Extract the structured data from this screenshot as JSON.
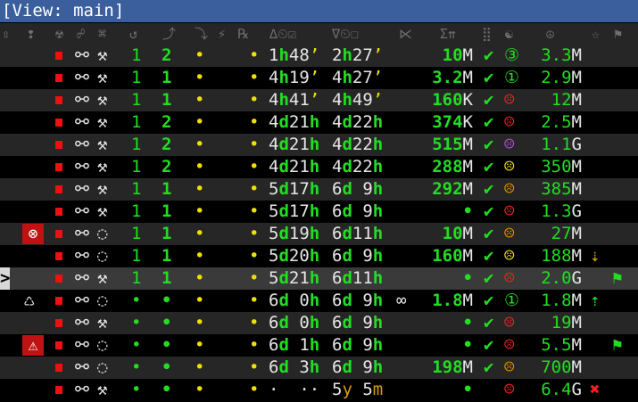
{
  "window": {
    "title": "[View: main]"
  },
  "header": {
    "columns": [
      "⇳",
      "❢",
      "☢",
      "☍",
      "⌘",
      "↺",
      "⤴",
      "⤵",
      "⚡",
      "℞",
      "∆⏲☑",
      "∇⏲☐",
      "⋉",
      "Σ⇈",
      "⣿",
      "☯",
      "☮",
      "☆",
      "⚑"
    ]
  },
  "rows": [
    {
      "cur": "",
      "icon": "",
      "red": true,
      "link": "⚯",
      "tool": "⚒",
      "a": "1",
      "b": "2",
      "c": "•",
      "d": "•",
      "t1": [
        [
          "1",
          "wht"
        ],
        [
          "h",
          "grn"
        ],
        [
          "48",
          "wht"
        ],
        [
          "’",
          "yel"
        ]
      ],
      "t2": [
        [
          "2",
          "wht"
        ],
        [
          "h",
          "grn"
        ],
        [
          "27",
          "wht"
        ],
        [
          "’",
          "yel"
        ]
      ],
      "inf": "",
      "size": [
        [
          "10",
          "grn"
        ],
        [
          "M",
          "wht"
        ]
      ],
      "chk": "✔",
      "face": "③",
      "fcol": "grn2",
      "tot": [
        [
          "3.3",
          "grn2"
        ],
        [
          "M",
          "wht"
        ]
      ],
      "ext": ""
    },
    {
      "cur": "",
      "icon": "",
      "red": true,
      "link": "⚯",
      "tool": "⚒",
      "a": "1",
      "b": "1",
      "c": "•",
      "d": "•",
      "t1": [
        [
          "4",
          "wht"
        ],
        [
          "h",
          "grn"
        ],
        [
          "19",
          "wht"
        ],
        [
          "’",
          "yel"
        ]
      ],
      "t2": [
        [
          "4",
          "wht"
        ],
        [
          "h",
          "grn"
        ],
        [
          "27",
          "wht"
        ],
        [
          "’",
          "yel"
        ]
      ],
      "inf": "",
      "size": [
        [
          "3.2",
          "grn"
        ],
        [
          "M",
          "wht"
        ]
      ],
      "chk": "✔",
      "face": "①",
      "fcol": "grn2",
      "tot": [
        [
          "2.9",
          "grn2"
        ],
        [
          "M",
          "wht"
        ]
      ],
      "ext": ""
    },
    {
      "cur": "",
      "icon": "",
      "red": true,
      "link": "⚯",
      "tool": "⚒",
      "a": "1",
      "b": "1",
      "c": "•",
      "d": "•",
      "t1": [
        [
          "4",
          "wht"
        ],
        [
          "h",
          "grn"
        ],
        [
          "41",
          "wht"
        ],
        [
          "’",
          "yel"
        ]
      ],
      "t2": [
        [
          "4",
          "wht"
        ],
        [
          "h",
          "grn"
        ],
        [
          "49",
          "wht"
        ],
        [
          "’",
          "yel"
        ]
      ],
      "inf": "",
      "size": [
        [
          "160",
          "grn"
        ],
        [
          "K",
          "wht"
        ]
      ],
      "chk": "✔",
      "face": "☹",
      "fcol": "red",
      "tot": [
        [
          "12",
          "grn2"
        ],
        [
          "M",
          "wht"
        ]
      ],
      "ext": ""
    },
    {
      "cur": "",
      "icon": "",
      "red": true,
      "link": "⚯",
      "tool": "⚒",
      "a": "1",
      "b": "2",
      "c": "•",
      "d": "•",
      "t1": [
        [
          "4",
          "wht"
        ],
        [
          "d",
          "grn"
        ],
        [
          "21",
          "wht"
        ],
        [
          "h",
          "grn"
        ]
      ],
      "t2": [
        [
          "4",
          "wht"
        ],
        [
          "d",
          "grn"
        ],
        [
          "22",
          "wht"
        ],
        [
          "h",
          "grn"
        ]
      ],
      "inf": "",
      "size": [
        [
          "374",
          "grn"
        ],
        [
          "K",
          "wht"
        ]
      ],
      "chk": "✔",
      "face": "☹",
      "fcol": "red",
      "tot": [
        [
          "2.5",
          "grn2"
        ],
        [
          "M",
          "wht"
        ]
      ],
      "ext": ""
    },
    {
      "cur": "",
      "icon": "",
      "red": true,
      "link": "⚯",
      "tool": "⚒",
      "a": "1",
      "b": "2",
      "c": "•",
      "d": "•",
      "t1": [
        [
          "4",
          "wht"
        ],
        [
          "d",
          "grn"
        ],
        [
          "21",
          "wht"
        ],
        [
          "h",
          "grn"
        ]
      ],
      "t2": [
        [
          "4",
          "wht"
        ],
        [
          "d",
          "grn"
        ],
        [
          "22",
          "wht"
        ],
        [
          "h",
          "grn"
        ]
      ],
      "inf": "",
      "size": [
        [
          "515",
          "grn"
        ],
        [
          "M",
          "wht"
        ]
      ],
      "chk": "✔",
      "face": "☹",
      "fcol": "prp",
      "tot": [
        [
          "1.1",
          "grn2"
        ],
        [
          "G",
          "wht"
        ]
      ],
      "ext": ""
    },
    {
      "cur": "",
      "icon": "",
      "red": true,
      "link": "⚯",
      "tool": "⚒",
      "a": "1",
      "b": "2",
      "c": "•",
      "d": "•",
      "t1": [
        [
          "4",
          "wht"
        ],
        [
          "d",
          "grn"
        ],
        [
          "21",
          "wht"
        ],
        [
          "h",
          "grn"
        ]
      ],
      "t2": [
        [
          "4",
          "wht"
        ],
        [
          "d",
          "grn"
        ],
        [
          "22",
          "wht"
        ],
        [
          "h",
          "grn"
        ]
      ],
      "inf": "",
      "size": [
        [
          "288",
          "grn"
        ],
        [
          "M",
          "wht"
        ]
      ],
      "chk": "✔",
      "face": "☹",
      "fcol": "yel",
      "tot": [
        [
          "350",
          "grn2"
        ],
        [
          "M",
          "wht"
        ]
      ],
      "ext": ""
    },
    {
      "cur": "",
      "icon": "",
      "red": true,
      "link": "⚯",
      "tool": "⚒",
      "a": "1",
      "b": "1",
      "c": "•",
      "d": "•",
      "t1": [
        [
          "5",
          "wht"
        ],
        [
          "d",
          "grn"
        ],
        [
          "17",
          "wht"
        ],
        [
          "h",
          "grn"
        ]
      ],
      "t2": [
        [
          "6",
          "wht"
        ],
        [
          "d",
          "grn"
        ],
        [
          " 9",
          "wht"
        ],
        [
          "h",
          "grn"
        ]
      ],
      "inf": "",
      "size": [
        [
          "292",
          "grn"
        ],
        [
          "M",
          "wht"
        ]
      ],
      "chk": "✔",
      "face": "☹",
      "fcol": "ora",
      "tot": [
        [
          "385",
          "grn2"
        ],
        [
          "M",
          "wht"
        ]
      ],
      "ext": ""
    },
    {
      "cur": "",
      "icon": "",
      "red": true,
      "link": "⚯",
      "tool": "⚒",
      "a": "1",
      "b": "1",
      "c": "•",
      "d": "•",
      "t1": [
        [
          "5",
          "wht"
        ],
        [
          "d",
          "grn"
        ],
        [
          "17",
          "wht"
        ],
        [
          "h",
          "grn"
        ]
      ],
      "t2": [
        [
          "6",
          "wht"
        ],
        [
          "d",
          "grn"
        ],
        [
          " 9",
          "wht"
        ],
        [
          "h",
          "grn"
        ]
      ],
      "inf": "",
      "size": [
        [
          "•",
          "grn"
        ]
      ],
      "chk": "✔",
      "face": "☹",
      "fcol": "red",
      "tot": [
        [
          "1.3",
          "grn2"
        ],
        [
          "G",
          "wht"
        ]
      ],
      "ext": ""
    },
    {
      "cur": "",
      "icon": "⊗",
      "red": true,
      "link": "⚯",
      "tool": "◌",
      "a": "1",
      "b": "1",
      "c": "•",
      "d": "•",
      "t1": [
        [
          "5",
          "wht"
        ],
        [
          "d",
          "grn"
        ],
        [
          "19",
          "wht"
        ],
        [
          "h",
          "grn"
        ]
      ],
      "t2": [
        [
          "6",
          "wht"
        ],
        [
          "d",
          "grn"
        ],
        [
          "11",
          "wht"
        ],
        [
          "h",
          "grn"
        ]
      ],
      "inf": "",
      "size": [
        [
          "10",
          "grn"
        ],
        [
          "M",
          "wht"
        ]
      ],
      "chk": "✔",
      "face": "☹",
      "fcol": "ora",
      "tot": [
        [
          "27",
          "grn2"
        ],
        [
          "M",
          "wht"
        ]
      ],
      "ext": ""
    },
    {
      "cur": "",
      "icon": "",
      "red": true,
      "link": "⚯",
      "tool": "◌",
      "a": "1",
      "b": "1",
      "c": "•",
      "d": "•",
      "t1": [
        [
          "5",
          "wht"
        ],
        [
          "d",
          "grn"
        ],
        [
          "20",
          "wht"
        ],
        [
          "h",
          "grn"
        ]
      ],
      "t2": [
        [
          "6",
          "wht"
        ],
        [
          "d",
          "grn"
        ],
        [
          " 9",
          "wht"
        ],
        [
          "h",
          "grn"
        ]
      ],
      "inf": "",
      "size": [
        [
          "160",
          "grn"
        ],
        [
          "M",
          "wht"
        ]
      ],
      "chk": "✔",
      "face": "☹",
      "fcol": "yel",
      "tot": [
        [
          "188",
          "grn2"
        ],
        [
          "M",
          "wht"
        ]
      ],
      "ext": "⇣"
    },
    {
      "cur": ">",
      "icon": "",
      "red": true,
      "link": "⚯",
      "tool": "⚒",
      "a": "1",
      "b": "1",
      "c": "•",
      "d": "•",
      "t1": [
        [
          "5",
          "wht"
        ],
        [
          "d",
          "grn"
        ],
        [
          "21",
          "wht"
        ],
        [
          "h",
          "grn"
        ]
      ],
      "t2": [
        [
          "6",
          "wht"
        ],
        [
          "d",
          "grn"
        ],
        [
          "11",
          "wht"
        ],
        [
          "h",
          "grn"
        ]
      ],
      "inf": "",
      "size": [
        [
          "•",
          "grn"
        ]
      ],
      "chk": "✔",
      "face": "☹",
      "fcol": "red",
      "tot": [
        [
          "2.0",
          "grn2"
        ],
        [
          "G",
          "wht"
        ]
      ],
      "ext": "⚑"
    },
    {
      "cur": "",
      "icon": "♺",
      "red": true,
      "link": "⚯",
      "tool": "◌",
      "a": "•",
      "b": "•",
      "c": "•",
      "d": "•",
      "t1": [
        [
          "6",
          "wht"
        ],
        [
          "d",
          "grn"
        ],
        [
          " 0",
          "wht"
        ],
        [
          "h",
          "grn"
        ]
      ],
      "t2": [
        [
          "6",
          "wht"
        ],
        [
          "d",
          "grn"
        ],
        [
          " 9",
          "wht"
        ],
        [
          "h",
          "grn"
        ]
      ],
      "inf": "∞",
      "size": [
        [
          "1.8",
          "grn"
        ],
        [
          "M",
          "wht"
        ]
      ],
      "chk": "✔",
      "face": "①",
      "fcol": "grn2",
      "tot": [
        [
          "1.8",
          "grn2"
        ],
        [
          "M",
          "wht"
        ]
      ],
      "ext": "⇡"
    },
    {
      "cur": "",
      "icon": "",
      "red": true,
      "link": "⚯",
      "tool": "⚒",
      "a": "•",
      "b": "•",
      "c": "•",
      "d": "•",
      "t1": [
        [
          "6",
          "wht"
        ],
        [
          "d",
          "grn"
        ],
        [
          " 0",
          "wht"
        ],
        [
          "h",
          "grn"
        ]
      ],
      "t2": [
        [
          "6",
          "wht"
        ],
        [
          "d",
          "grn"
        ],
        [
          " 9",
          "wht"
        ],
        [
          "h",
          "grn"
        ]
      ],
      "inf": "",
      "size": [
        [
          "•",
          "grn"
        ]
      ],
      "chk": "✔",
      "face": "☹",
      "fcol": "red",
      "tot": [
        [
          "19",
          "grn2"
        ],
        [
          "M",
          "wht"
        ]
      ],
      "ext": ""
    },
    {
      "cur": "",
      "icon": "⚠",
      "red": true,
      "link": "⚯",
      "tool": "◌",
      "a": "•",
      "b": "•",
      "c": "•",
      "d": "•",
      "t1": [
        [
          "6",
          "wht"
        ],
        [
          "d",
          "grn"
        ],
        [
          " 1",
          "wht"
        ],
        [
          "h",
          "grn"
        ]
      ],
      "t2": [
        [
          "6",
          "wht"
        ],
        [
          "d",
          "grn"
        ],
        [
          " 9",
          "wht"
        ],
        [
          "h",
          "grn"
        ]
      ],
      "inf": "",
      "size": [
        [
          "•",
          "grn"
        ]
      ],
      "chk": "✔",
      "face": "☹",
      "fcol": "red",
      "tot": [
        [
          "5.5",
          "grn2"
        ],
        [
          "M",
          "wht"
        ]
      ],
      "ext": "⚑"
    },
    {
      "cur": "",
      "icon": "",
      "red": true,
      "link": "⚯",
      "tool": "◌",
      "a": "•",
      "b": "•",
      "c": "•",
      "d": "•",
      "t1": [
        [
          "6",
          "wht"
        ],
        [
          "d",
          "grn"
        ],
        [
          " 3",
          "wht"
        ],
        [
          "h",
          "grn"
        ]
      ],
      "t2": [
        [
          "6",
          "wht"
        ],
        [
          "d",
          "grn"
        ],
        [
          " 9",
          "wht"
        ],
        [
          "h",
          "grn"
        ]
      ],
      "inf": "",
      "size": [
        [
          "198",
          "grn"
        ],
        [
          "M",
          "wht"
        ]
      ],
      "chk": "✔",
      "face": "☹",
      "fcol": "ora",
      "tot": [
        [
          "700",
          "grn2"
        ],
        [
          "M",
          "wht"
        ]
      ],
      "ext": ""
    },
    {
      "cur": "",
      "icon": "",
      "red": true,
      "link": "⚯",
      "tool": "⚒",
      "a": "•",
      "b": "•",
      "c": "•",
      "d": "•",
      "t1": [
        [
          "·  ··",
          "wht"
        ]
      ],
      "t2": [
        [
          "5",
          "wht"
        ],
        [
          "y",
          "gold"
        ],
        [
          " 5",
          "wht"
        ],
        [
          "m",
          "gold"
        ]
      ],
      "inf": "",
      "size": [
        [
          "•",
          "grn"
        ]
      ],
      "chk": "",
      "face": "☹",
      "fcol": "red",
      "tot": [
        [
          "6.4",
          "grn2"
        ],
        [
          "G",
          "wht"
        ]
      ],
      "ext": "✖"
    }
  ]
}
